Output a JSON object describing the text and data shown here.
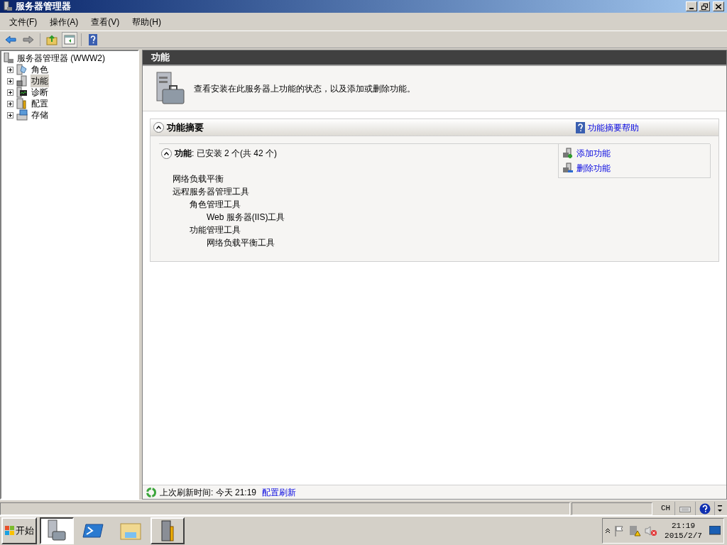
{
  "window": {
    "title": "服务器管理器"
  },
  "menu": [
    "文件(F)",
    "操作(A)",
    "查看(V)",
    "帮助(H)"
  ],
  "toolbar": [
    {
      "kind": "back",
      "pressed": false
    },
    {
      "kind": "forward",
      "pressed": false
    },
    {
      "kind": "up",
      "pressed": false
    },
    {
      "kind": "pane",
      "pressed": true
    },
    {
      "kind": "help",
      "pressed": false
    }
  ],
  "tree": {
    "label": "服务器管理器 (WWW2)",
    "children": [
      {
        "label": "角色",
        "kind": "roles",
        "expanded": false,
        "selected": false
      },
      {
        "label": "功能",
        "kind": "features",
        "expanded": false,
        "selected": true
      },
      {
        "label": "诊断",
        "kind": "diagnostics",
        "expanded": false,
        "selected": false
      },
      {
        "label": "配置",
        "kind": "configuration",
        "expanded": false,
        "selected": false
      },
      {
        "label": "存储",
        "kind": "storage",
        "expanded": false,
        "selected": false
      }
    ]
  },
  "panel": {
    "title": "功能",
    "description": "查看安装在此服务器上功能的状态，以及添加或删除功能。",
    "section": {
      "title": "功能摘要",
      "expanded": true,
      "help_link": "功能摘要帮助",
      "subsection": {
        "title": "**功能**: 已安装 2 个(共 42 个)",
        "expanded": true,
        "features": [
          {
            "label": "网络负载平衡"
          },
          {
            "label": "远程服务器管理工具",
            "children": [
              {
                "label": "角色管理工具",
                "children": [
                  {
                    "label": "Web 服务器(IIS)工具"
                  }
                ]
              },
              {
                "label": "功能管理工具",
                "children": [
                  {
                    "label": "网络负载平衡工具"
                  }
                ]
              }
            ]
          }
        ],
        "actions": [
          {
            "kind": "add",
            "label": "添加功能"
          },
          {
            "kind": "remove",
            "label": "删除功能"
          }
        ]
      }
    },
    "refresh": {
      "text": "上次刷新时间: 今天 21:19",
      "link": "配置刷新"
    }
  },
  "language_bar": {
    "language": "CH"
  },
  "taskbar": {
    "start": "开始",
    "apps": [
      {
        "kind": "server-manager",
        "selected": true
      },
      {
        "kind": "powershell",
        "selected": false
      },
      {
        "kind": "explorer",
        "selected": false
      },
      {
        "kind": "tools",
        "selected": false
      }
    ],
    "clock": {
      "time": "21:19",
      "date": "2015/2/7"
    }
  }
}
